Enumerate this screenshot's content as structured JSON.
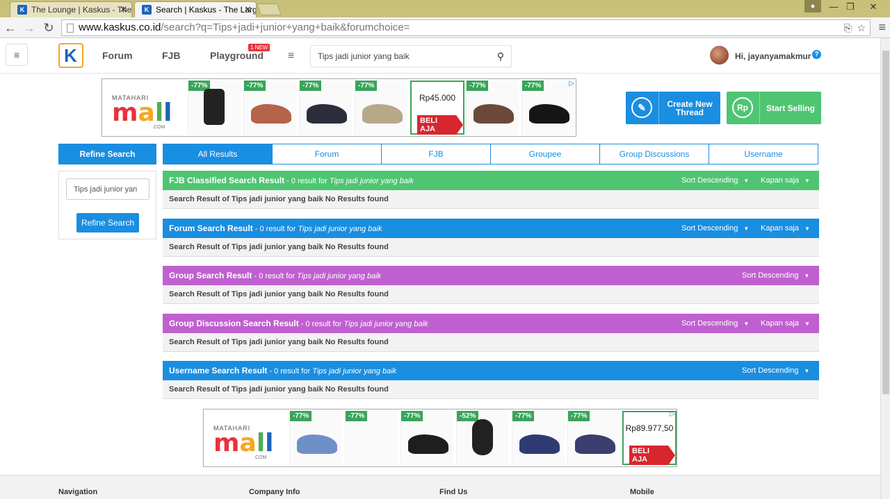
{
  "browser": {
    "tabs": [
      {
        "title": "The Lounge | Kaskus - The"
      },
      {
        "title": "Search | Kaskus - The Larg"
      }
    ],
    "url_host": "www.kaskus.co.id",
    "url_path": "/search?q=Tips+jadi+junior+yang+baik&forumchoice="
  },
  "header": {
    "logo_letter": "K",
    "nav": {
      "forum": "Forum",
      "fjb": "FJB",
      "playground": "Playground"
    },
    "new_badge": "1 NEW",
    "search_value": "Tips jadi junior yang baik",
    "greeting": "Hi, jayanyamakmur",
    "help": "?"
  },
  "ad_top": {
    "brand_top": "MATAHARI",
    "brand_main": [
      "m",
      "a",
      "l",
      "l"
    ],
    "brand_com": ".COM",
    "discounts": [
      "-77%",
      "-77%",
      "-77%",
      "-77%",
      "-77%",
      "-77%"
    ],
    "price": "Rp45.000",
    "buy": "BELI AJA"
  },
  "ad_bottom": {
    "brand_top": "MATAHARI",
    "brand_main": [
      "m",
      "a",
      "l",
      "l"
    ],
    "brand_com": ".COM",
    "discounts": [
      "-77%",
      "-77%",
      "-77%",
      "-52%",
      "-77%",
      "-77%"
    ],
    "price": "Rp89.977,50",
    "buy": "BELI AJA"
  },
  "actions": {
    "create_thread": "Create New Thread",
    "start_selling": "Start Selling",
    "rp": "Rp"
  },
  "sidebar": {
    "title": "Refine Search",
    "input_value": "Tips jadi junior yan",
    "button": "Refine Search"
  },
  "result_tabs": [
    "All Results",
    "Forum",
    "FJB",
    "Groupee",
    "Group Discussions",
    "Username"
  ],
  "results": [
    {
      "title": "FJB Classified Search Result",
      "count": " - 0 result for ",
      "query": "Tips jadi junior yang baik",
      "sort": "Sort Descending",
      "time": "Kapan saja",
      "body": "Search Result of Tips jadi junior yang baik No Results found",
      "color": "#4fc572"
    },
    {
      "title": "Forum Search Result",
      "count": " - 0 result for ",
      "query": "Tips jadi junior yang baik",
      "sort": "Sort Descending",
      "time": "Kapan saja",
      "body": "Search Result of Tips jadi junior yang baik No Results found",
      "color": "#1a8ee1"
    },
    {
      "title": "Group Search Result",
      "count": " - 0 result for ",
      "query": "Tips jadi junior yang baik",
      "sort": "Sort Descending",
      "time": "",
      "body": "Search Result of Tips jadi junior yang baik No Results found",
      "color": "#c060d0"
    },
    {
      "title": "Group Discussion Search Result",
      "count": " - 0 result for ",
      "query": "Tips jadi junior yang baik",
      "sort": "Sort Descending",
      "time": "Kapan saja",
      "body": "Search Result of Tips jadi junior yang baik No Results found",
      "color": "#c060d0"
    },
    {
      "title": "Username Search Result",
      "count": " - 0 result for ",
      "query": "Tips jadi junior yang baik",
      "sort": "Sort Descending",
      "time": "",
      "body": "Search Result of Tips jadi junior yang baik No Results found",
      "color": "#1a8ee1"
    }
  ],
  "footer": {
    "navigation": "Navigation",
    "company": "Company Info",
    "find_us": "Find Us",
    "mobile": "Mobile"
  }
}
